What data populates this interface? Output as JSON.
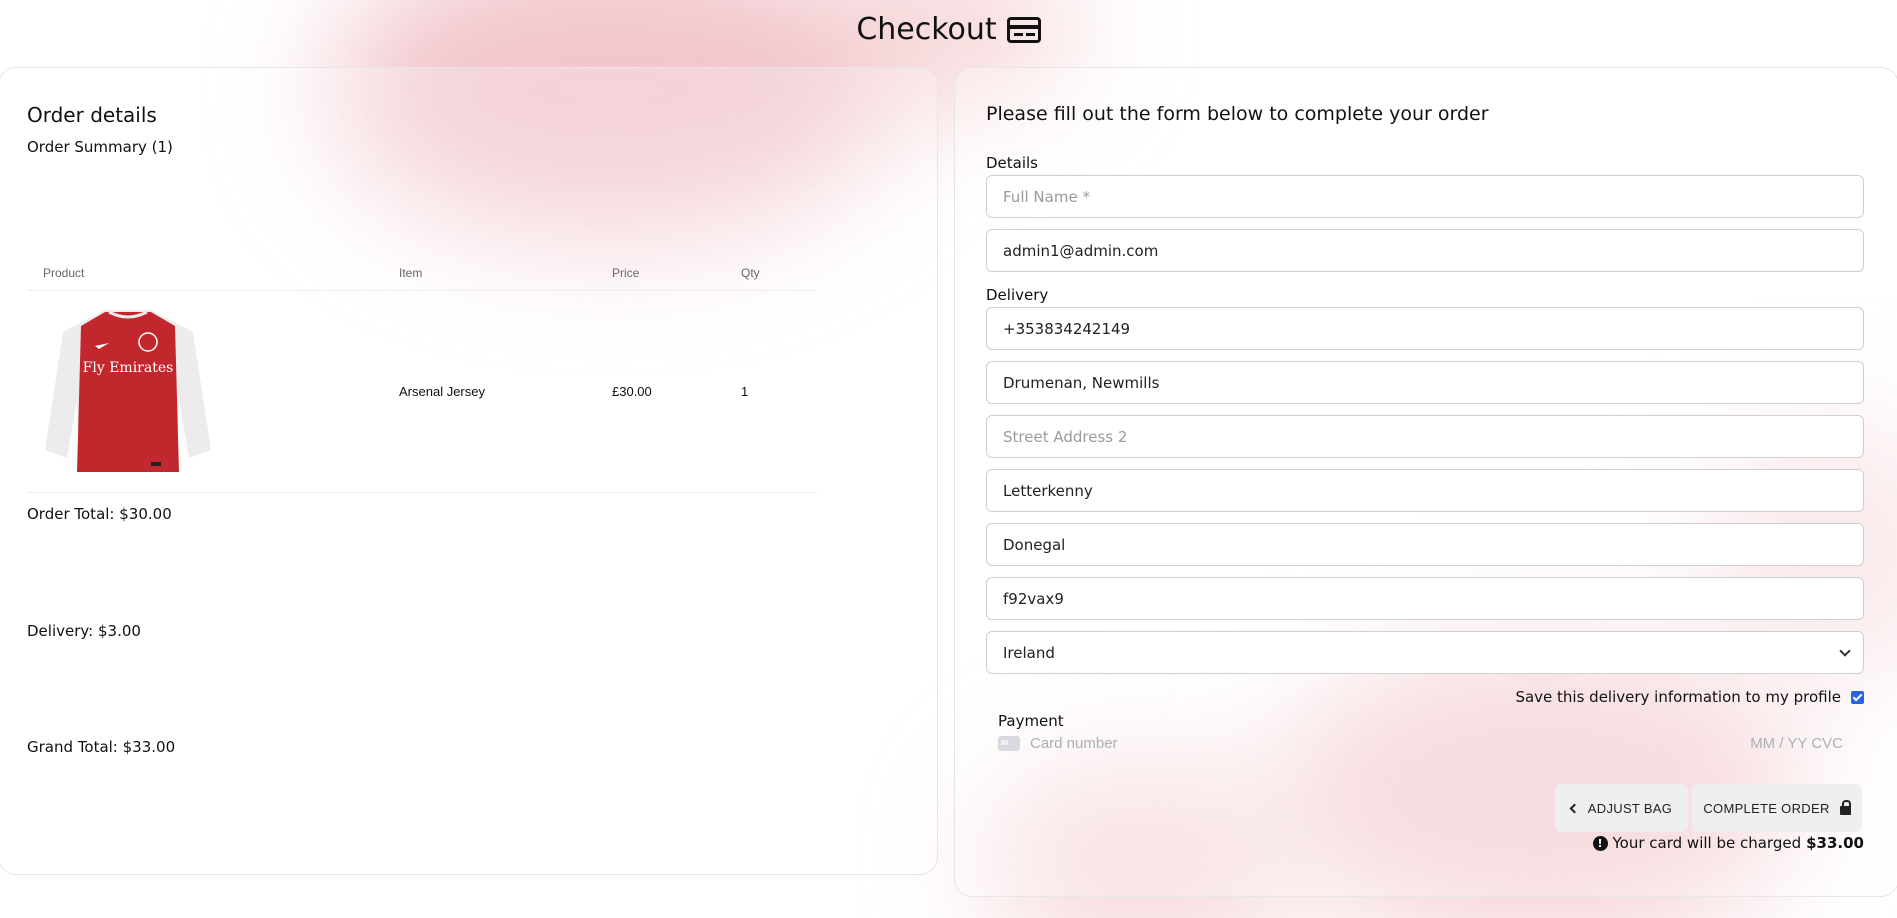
{
  "page_title": "Checkout",
  "order": {
    "heading": "Order details",
    "summary": "Order Summary (1)",
    "columns": [
      "Product",
      "Item",
      "Price",
      "Qty"
    ],
    "items": [
      {
        "image_alt": "Fly Emirates",
        "name": "Arsenal Jersey",
        "price": "£30.00",
        "qty": "1"
      }
    ],
    "order_total": "Order Total: $30.00",
    "delivery": "Delivery: $3.00",
    "grand_total": "Grand Total: $33.00"
  },
  "form": {
    "heading": "Please fill out the form below to complete your order",
    "details_label": "Details",
    "full_name_placeholder": "Full Name *",
    "email_value": "admin1@admin.com",
    "delivery_label": "Delivery",
    "phone_value": "+353834242149",
    "street1_value": "Drumenan, Newmills",
    "street2_placeholder": "Street Address 2",
    "town_value": "Letterkenny",
    "county_value": "Donegal",
    "postcode_value": "f92vax9",
    "country_value": "Ireland",
    "save_label": "Save this delivery information to my profile",
    "save_checked": true,
    "payment_label": "Payment",
    "card_placeholder": "Card number",
    "expiry_placeholder": "MM / YY  CVC",
    "adjust_label": "ADJUST BAG",
    "complete_label": "COMPLETE ORDER",
    "charge_text": "Your card will be charged",
    "charge_amount": "$33.00"
  },
  "colors": {
    "accent_checkbox": "#2563eb",
    "button_bg": "#efefef",
    "background_blush": "#e696a0"
  }
}
